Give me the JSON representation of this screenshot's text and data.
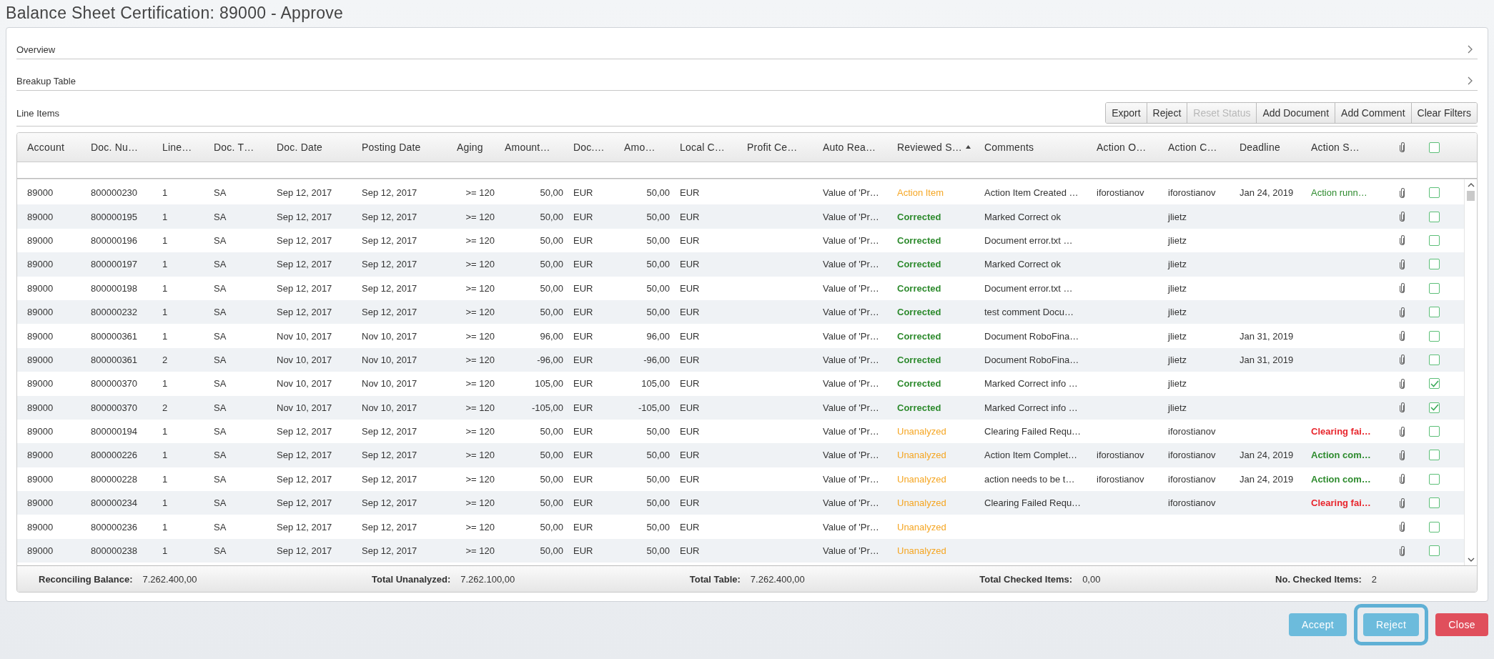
{
  "title": "Balance Sheet Certification: 89000 - Approve",
  "sections": [
    {
      "label": "Overview",
      "expanded": false
    },
    {
      "label": "Breakup Table",
      "expanded": false
    }
  ],
  "line_items": {
    "label": "Line Items",
    "toolbar": [
      {
        "label": "Export",
        "disabled": false
      },
      {
        "label": "Reject",
        "disabled": false
      },
      {
        "label": "Reset Status",
        "disabled": true
      },
      {
        "label": "Add Document",
        "disabled": false
      },
      {
        "label": "Add Comment",
        "disabled": false
      },
      {
        "label": "Clear Filters",
        "disabled": false
      }
    ],
    "columns": [
      {
        "label": "Account"
      },
      {
        "label": "Doc. Nu…"
      },
      {
        "label": "Line…"
      },
      {
        "label": "Doc. T…"
      },
      {
        "label": "Doc. Date"
      },
      {
        "label": "Posting Date"
      },
      {
        "label": "Aging"
      },
      {
        "label": "Amount…"
      },
      {
        "label": "Doc.…"
      },
      {
        "label": "Amo…"
      },
      {
        "label": "Local C…"
      },
      {
        "label": "Profit Ce…"
      },
      {
        "label": "Auto Rea…"
      },
      {
        "label": "Reviewed S…",
        "sorted": true
      },
      {
        "label": "Comments"
      },
      {
        "label": "Action O…"
      },
      {
        "label": "Action C…"
      },
      {
        "label": "Deadline"
      },
      {
        "label": "Action S…"
      }
    ],
    "header_checked": false,
    "rows": [
      {
        "account": "89000",
        "doc_number": "800000230",
        "line": "1",
        "doc_type": "SA",
        "doc_date": "Sep 12, 2017",
        "posting_date": "Sep 12, 2017",
        "aging": ">= 120",
        "amount": "50,00",
        "doc_currency": "EUR",
        "amount_local": "50,00",
        "local_currency": "EUR",
        "auto_reason": "Value of 'Pr…",
        "reviewed_status": {
          "text": "Action Item",
          "kind": "action_item"
        },
        "comments": "Action Item Created …",
        "action_owner": "iforostianov",
        "action_creator": "iforostianov",
        "deadline": "Jan 24, 2019",
        "action_status": {
          "text": "Action runn…",
          "kind": "running"
        },
        "checked": false
      },
      {
        "account": "89000",
        "doc_number": "800000195",
        "line": "1",
        "doc_type": "SA",
        "doc_date": "Sep 12, 2017",
        "posting_date": "Sep 12, 2017",
        "aging": ">= 120",
        "amount": "50,00",
        "doc_currency": "EUR",
        "amount_local": "50,00",
        "local_currency": "EUR",
        "auto_reason": "Value of 'Pr…",
        "reviewed_status": {
          "text": "Corrected",
          "kind": "corrected"
        },
        "comments": "Marked Correct ok",
        "action_creator": "jlietz",
        "checked": false
      },
      {
        "account": "89000",
        "doc_number": "800000196",
        "line": "1",
        "doc_type": "SA",
        "doc_date": "Sep 12, 2017",
        "posting_date": "Sep 12, 2017",
        "aging": ">= 120",
        "amount": "50,00",
        "doc_currency": "EUR",
        "amount_local": "50,00",
        "local_currency": "EUR",
        "auto_reason": "Value of 'Pr…",
        "reviewed_status": {
          "text": "Corrected",
          "kind": "corrected"
        },
        "comments": "Document error.txt …",
        "action_creator": "jlietz",
        "checked": false
      },
      {
        "account": "89000",
        "doc_number": "800000197",
        "line": "1",
        "doc_type": "SA",
        "doc_date": "Sep 12, 2017",
        "posting_date": "Sep 12, 2017",
        "aging": ">= 120",
        "amount": "50,00",
        "doc_currency": "EUR",
        "amount_local": "50,00",
        "local_currency": "EUR",
        "auto_reason": "Value of 'Pr…",
        "reviewed_status": {
          "text": "Corrected",
          "kind": "corrected"
        },
        "comments": "Marked Correct ok",
        "action_creator": "jlietz",
        "checked": false
      },
      {
        "account": "89000",
        "doc_number": "800000198",
        "line": "1",
        "doc_type": "SA",
        "doc_date": "Sep 12, 2017",
        "posting_date": "Sep 12, 2017",
        "aging": ">= 120",
        "amount": "50,00",
        "doc_currency": "EUR",
        "amount_local": "50,00",
        "local_currency": "EUR",
        "auto_reason": "Value of 'Pr…",
        "reviewed_status": {
          "text": "Corrected",
          "kind": "corrected"
        },
        "comments": "Document error.txt …",
        "action_creator": "jlietz",
        "checked": false
      },
      {
        "account": "89000",
        "doc_number": "800000232",
        "line": "1",
        "doc_type": "SA",
        "doc_date": "Sep 12, 2017",
        "posting_date": "Sep 12, 2017",
        "aging": ">= 120",
        "amount": "50,00",
        "doc_currency": "EUR",
        "amount_local": "50,00",
        "local_currency": "EUR",
        "auto_reason": "Value of 'Pr…",
        "reviewed_status": {
          "text": "Corrected",
          "kind": "corrected"
        },
        "comments": "test comment Docu…",
        "action_creator": "jlietz",
        "checked": false
      },
      {
        "account": "89000",
        "doc_number": "800000361",
        "line": "1",
        "doc_type": "SA",
        "doc_date": "Nov 10, 2017",
        "posting_date": "Nov 10, 2017",
        "aging": ">= 120",
        "amount": "96,00",
        "doc_currency": "EUR",
        "amount_local": "96,00",
        "local_currency": "EUR",
        "auto_reason": "Value of 'Pr…",
        "reviewed_status": {
          "text": "Corrected",
          "kind": "corrected"
        },
        "comments": "Document RoboFina…",
        "action_creator": "jlietz",
        "deadline": "Jan 31, 2019",
        "checked": false
      },
      {
        "account": "89000",
        "doc_number": "800000361",
        "line": "2",
        "doc_type": "SA",
        "doc_date": "Nov 10, 2017",
        "posting_date": "Nov 10, 2017",
        "aging": ">= 120",
        "amount": "-96,00",
        "doc_currency": "EUR",
        "amount_local": "-96,00",
        "local_currency": "EUR",
        "auto_reason": "Value of 'Pr…",
        "reviewed_status": {
          "text": "Corrected",
          "kind": "corrected"
        },
        "comments": "Document RoboFina…",
        "action_creator": "jlietz",
        "deadline": "Jan 31, 2019",
        "checked": false
      },
      {
        "account": "89000",
        "doc_number": "800000370",
        "line": "1",
        "doc_type": "SA",
        "doc_date": "Nov 10, 2017",
        "posting_date": "Nov 10, 2017",
        "aging": ">= 120",
        "amount": "105,00",
        "doc_currency": "EUR",
        "amount_local": "105,00",
        "local_currency": "EUR",
        "auto_reason": "Value of 'Pr…",
        "reviewed_status": {
          "text": "Corrected",
          "kind": "corrected"
        },
        "comments": "Marked Correct info …",
        "action_creator": "jlietz",
        "checked": true
      },
      {
        "account": "89000",
        "doc_number": "800000370",
        "line": "2",
        "doc_type": "SA",
        "doc_date": "Nov 10, 2017",
        "posting_date": "Nov 10, 2017",
        "aging": ">= 120",
        "amount": "-105,00",
        "doc_currency": "EUR",
        "amount_local": "-105,00",
        "local_currency": "EUR",
        "auto_reason": "Value of 'Pr…",
        "reviewed_status": {
          "text": "Corrected",
          "kind": "corrected"
        },
        "comments": "Marked Correct info …",
        "action_creator": "jlietz",
        "checked": true
      },
      {
        "account": "89000",
        "doc_number": "800000194",
        "line": "1",
        "doc_type": "SA",
        "doc_date": "Sep 12, 2017",
        "posting_date": "Sep 12, 2017",
        "aging": ">= 120",
        "amount": "50,00",
        "doc_currency": "EUR",
        "amount_local": "50,00",
        "local_currency": "EUR",
        "auto_reason": "Value of 'Pr…",
        "reviewed_status": {
          "text": "Unanalyzed",
          "kind": "unanalyzed"
        },
        "comments": "Clearing Failed Requ…",
        "action_creator": "iforostianov",
        "action_status": {
          "text": "Clearing fai…",
          "kind": "failed"
        },
        "checked": false
      },
      {
        "account": "89000",
        "doc_number": "800000226",
        "line": "1",
        "doc_type": "SA",
        "doc_date": "Sep 12, 2017",
        "posting_date": "Sep 12, 2017",
        "aging": ">= 120",
        "amount": "50,00",
        "doc_currency": "EUR",
        "amount_local": "50,00",
        "local_currency": "EUR",
        "auto_reason": "Value of 'Pr…",
        "reviewed_status": {
          "text": "Unanalyzed",
          "kind": "unanalyzed"
        },
        "comments": "Action Item Complet…",
        "action_owner": "iforostianov",
        "action_creator": "iforostianov",
        "deadline": "Jan 24, 2019",
        "action_status": {
          "text": "Action com…",
          "kind": "completed"
        },
        "checked": false
      },
      {
        "account": "89000",
        "doc_number": "800000228",
        "line": "1",
        "doc_type": "SA",
        "doc_date": "Sep 12, 2017",
        "posting_date": "Sep 12, 2017",
        "aging": ">= 120",
        "amount": "50,00",
        "doc_currency": "EUR",
        "amount_local": "50,00",
        "local_currency": "EUR",
        "auto_reason": "Value of 'Pr…",
        "reviewed_status": {
          "text": "Unanalyzed",
          "kind": "unanalyzed"
        },
        "comments": "action needs to be t…",
        "action_owner": "iforostianov",
        "action_creator": "iforostianov",
        "deadline": "Jan 24, 2019",
        "action_status": {
          "text": "Action com…",
          "kind": "completed"
        },
        "checked": false
      },
      {
        "account": "89000",
        "doc_number": "800000234",
        "line": "1",
        "doc_type": "SA",
        "doc_date": "Sep 12, 2017",
        "posting_date": "Sep 12, 2017",
        "aging": ">= 120",
        "amount": "50,00",
        "doc_currency": "EUR",
        "amount_local": "50,00",
        "local_currency": "EUR",
        "auto_reason": "Value of 'Pr…",
        "reviewed_status": {
          "text": "Unanalyzed",
          "kind": "unanalyzed"
        },
        "comments": "Clearing Failed Requ…",
        "action_creator": "iforostianov",
        "action_status": {
          "text": "Clearing fai…",
          "kind": "failed"
        },
        "checked": false
      },
      {
        "account": "89000",
        "doc_number": "800000236",
        "line": "1",
        "doc_type": "SA",
        "doc_date": "Sep 12, 2017",
        "posting_date": "Sep 12, 2017",
        "aging": ">= 120",
        "amount": "50,00",
        "doc_currency": "EUR",
        "amount_local": "50,00",
        "local_currency": "EUR",
        "auto_reason": "Value of 'Pr…",
        "reviewed_status": {
          "text": "Unanalyzed",
          "kind": "unanalyzed"
        },
        "checked": false
      },
      {
        "account": "89000",
        "doc_number": "800000238",
        "line": "1",
        "doc_type": "SA",
        "doc_date": "Sep 12, 2017",
        "posting_date": "Sep 12, 2017",
        "aging": ">= 120",
        "amount": "50,00",
        "doc_currency": "EUR",
        "amount_local": "50,00",
        "local_currency": "EUR",
        "auto_reason": "Value of 'Pr…",
        "reviewed_status": {
          "text": "Unanalyzed",
          "kind": "unanalyzed"
        },
        "checked": false
      }
    ],
    "summary": [
      {
        "label": "Reconciling Balance:",
        "value": "7.262.400,00"
      },
      {
        "label": "Total Unanalyzed:",
        "value": "7.262.100,00"
      },
      {
        "label": "Total Table:",
        "value": "7.262.400,00"
      },
      {
        "label": "Total Checked Items:",
        "value": "0,00"
      },
      {
        "label": "No. Checked Items:",
        "value": "2"
      }
    ]
  },
  "actions": [
    {
      "label": "Accept",
      "kind": "accept",
      "highlighted": false
    },
    {
      "label": "Reject",
      "kind": "reject",
      "highlighted": true
    },
    {
      "label": "Close",
      "kind": "close",
      "highlighted": false
    }
  ]
}
